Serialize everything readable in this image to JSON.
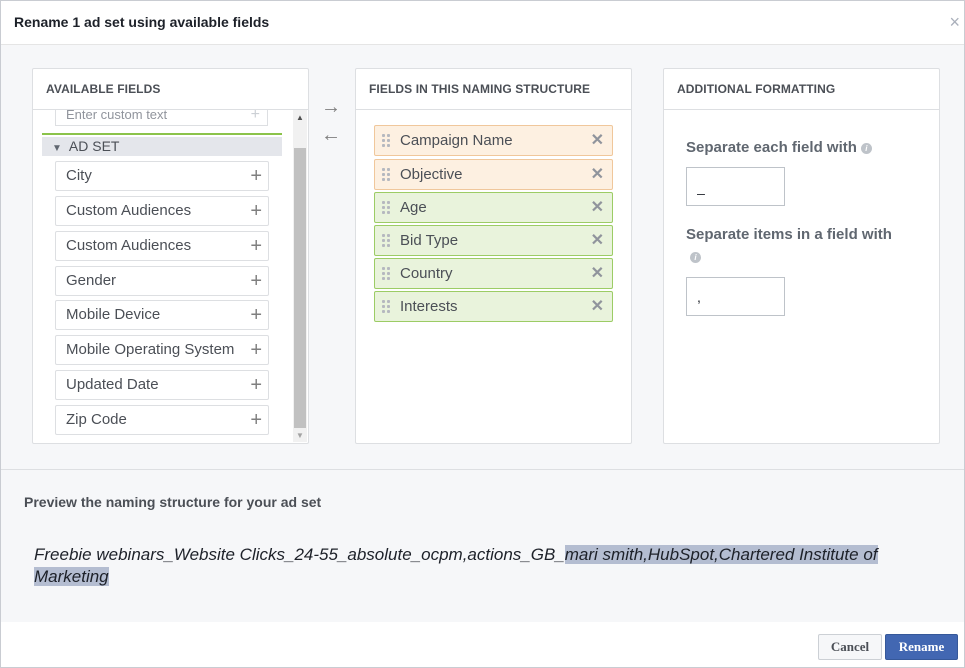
{
  "dialog": {
    "title": "Rename 1 ad set using available fields",
    "close_icon": "×"
  },
  "available": {
    "heading": "AVAILABLE FIELDS",
    "custom_placeholder": "Enter custom text",
    "group_label": "AD SET",
    "items": [
      {
        "label": "City"
      },
      {
        "label": "Custom Audiences"
      },
      {
        "label": "Custom Audiences"
      },
      {
        "label": "Gender"
      },
      {
        "label": "Mobile Device"
      },
      {
        "label": "Mobile Operating System"
      },
      {
        "label": "Updated Date"
      },
      {
        "label": "Zip Code"
      }
    ]
  },
  "arrows": {
    "add": "→",
    "remove": "←"
  },
  "structure": {
    "heading": "FIELDS IN THIS NAMING STRUCTURE",
    "chips": [
      {
        "label": "Campaign Name",
        "color": "orange"
      },
      {
        "label": "Objective",
        "color": "orange"
      },
      {
        "label": "Age",
        "color": "green"
      },
      {
        "label": "Bid Type",
        "color": "green"
      },
      {
        "label": "Country",
        "color": "green"
      },
      {
        "label": "Interests",
        "color": "green"
      }
    ]
  },
  "formatting": {
    "heading": "ADDITIONAL FORMATTING",
    "separate_fields_label": "Separate each field with",
    "separate_fields_value": "_",
    "separate_items_label": "Separate items in a field with",
    "separate_items_value": ","
  },
  "preview": {
    "title": "Preview the naming structure for your ad set",
    "text_plain": "Freebie webinars_Website Clicks_24-55_absolute_ocpm,actions_GB_",
    "text_highlighted": "mari smith,HubSpot,Chartered Institute of Marketing"
  },
  "footer": {
    "cancel_label": "Cancel",
    "rename_label": "Rename"
  },
  "colors": {
    "primary": "#4267b2",
    "orange_chip": "#fdf0e1",
    "green_chip": "#e9f3dc",
    "group_line": "#8bc34a"
  }
}
